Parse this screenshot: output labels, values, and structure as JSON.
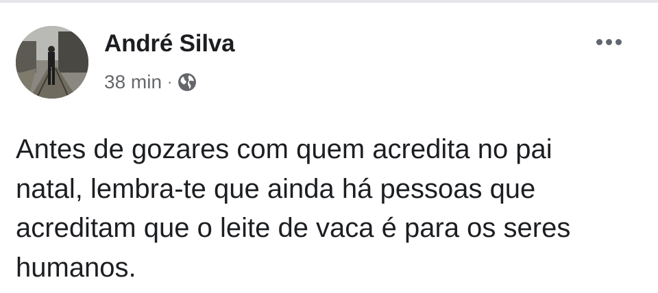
{
  "post": {
    "author": "André Silva",
    "time": "38 min",
    "separator": "·",
    "audience_icon": "globe-icon",
    "more_icon": "more-options-icon",
    "text": "Antes de gozares com quem acredita no pai\nnatal, lembra-te que ainda há pessoas que\nacreditam que o leite de vaca é para os seres\nhumanos."
  },
  "colors": {
    "text_primary": "#1c1e21",
    "text_secondary": "#65676b",
    "icon_gray": "#606770",
    "background": "#ffffff"
  }
}
